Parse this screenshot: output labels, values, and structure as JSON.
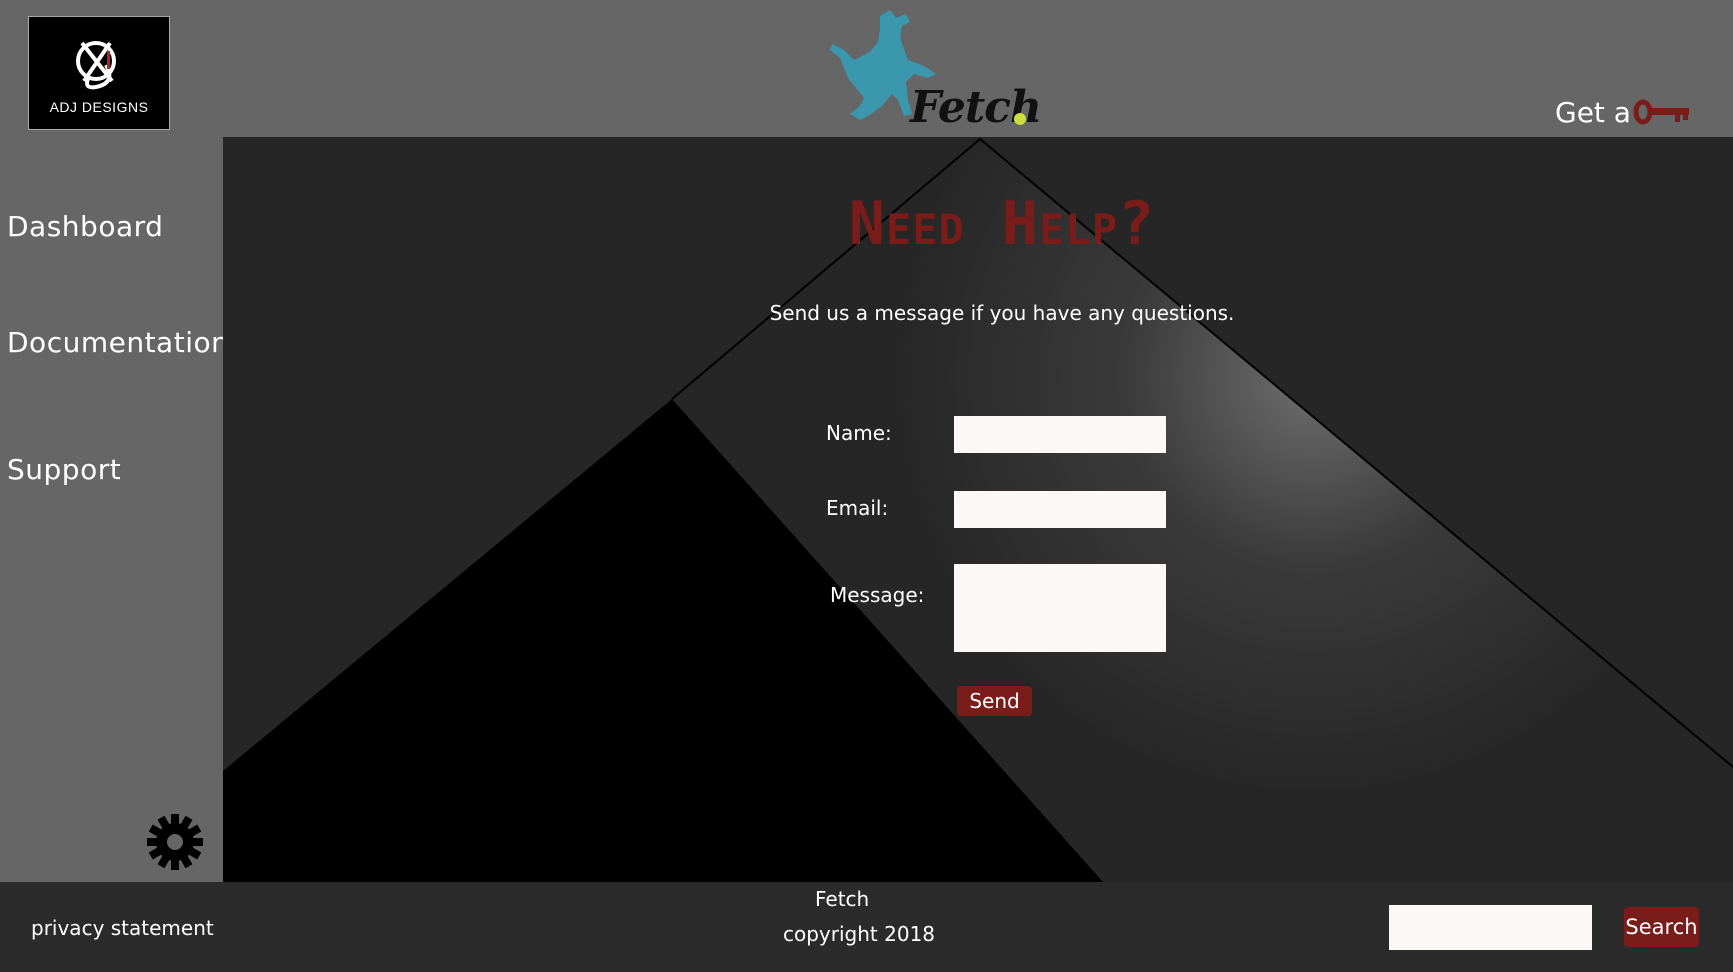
{
  "header": {
    "logo_text": "ADJ DESIGNS",
    "brand_name": "Fetch",
    "get_key_label": "Get a"
  },
  "sidebar": {
    "items": [
      {
        "label": "Dashboard"
      },
      {
        "label": "Documentation"
      },
      {
        "label": "Support"
      }
    ]
  },
  "main": {
    "title": "Need Help?",
    "subtitle": "Send us a message if you have any questions.",
    "form": {
      "name_label": "Name:",
      "email_label": "Email:",
      "message_label": "Message:",
      "name_value": "",
      "email_value": "",
      "message_value": "",
      "send_label": "Send"
    }
  },
  "footer": {
    "privacy_label": "privacy statement",
    "brand": "Fetch",
    "copyright": "copyright 2018",
    "search_value": "",
    "search_label": "Search"
  },
  "colors": {
    "accent": "#7a1c1a",
    "dog": "#3a97ad",
    "panel": "#666666",
    "footer": "#2b2b2b"
  },
  "icons": [
    "adj-designs-logo",
    "dog-icon",
    "key-icon",
    "gear-icon"
  ]
}
